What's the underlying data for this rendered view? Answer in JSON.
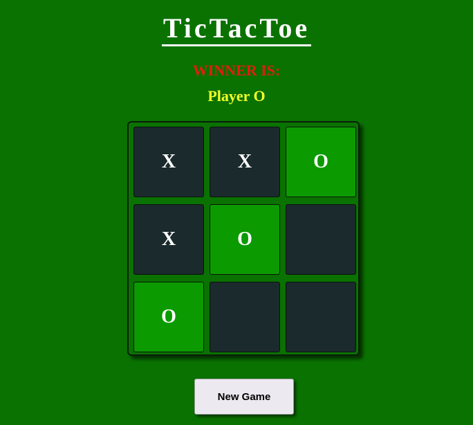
{
  "app": {
    "title": "TicTacToe"
  },
  "status": {
    "winner_label": "WINNER IS:",
    "winner_name": "Player O"
  },
  "board": {
    "cells": [
      {
        "value": "X",
        "winning": false
      },
      {
        "value": "X",
        "winning": false
      },
      {
        "value": "O",
        "winning": true
      },
      {
        "value": "X",
        "winning": false
      },
      {
        "value": "O",
        "winning": true
      },
      {
        "value": "",
        "winning": false
      },
      {
        "value": "O",
        "winning": true
      },
      {
        "value": "",
        "winning": false
      },
      {
        "value": "",
        "winning": false
      }
    ]
  },
  "controls": {
    "new_game_label": "New Game"
  },
  "colors": {
    "background": "#0a7200",
    "cell": "#1b2a2c",
    "winning_cell": "#0b9a00",
    "winner_label": "#e01e10",
    "winner_name": "#f2ff2a"
  }
}
